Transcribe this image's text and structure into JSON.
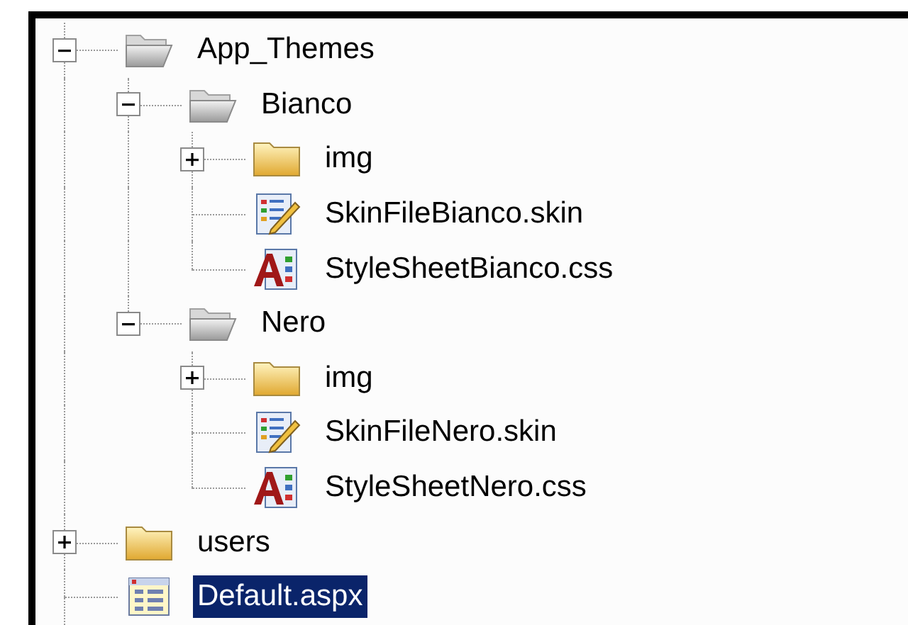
{
  "tree": [
    {
      "label": "App_Themes",
      "kind": "folder",
      "expanded": true,
      "selected": false,
      "children": [
        {
          "label": "Bianco",
          "kind": "folder",
          "expanded": true,
          "selected": false,
          "children": [
            {
              "label": "img",
              "kind": "folder",
              "expanded": false,
              "selected": false
            },
            {
              "label": "SkinFileBianco.skin",
              "kind": "skin",
              "selected": false
            },
            {
              "label": "StyleSheetBianco.css",
              "kind": "css",
              "selected": false
            }
          ]
        },
        {
          "label": "Nero",
          "kind": "folder",
          "expanded": true,
          "selected": false,
          "children": [
            {
              "label": "img",
              "kind": "folder",
              "expanded": false,
              "selected": false
            },
            {
              "label": "SkinFileNero.skin",
              "kind": "skin",
              "selected": false
            },
            {
              "label": "StyleSheetNero.css",
              "kind": "css",
              "selected": false
            }
          ]
        }
      ]
    },
    {
      "label": "users",
      "kind": "folder",
      "expanded": false,
      "selected": false
    },
    {
      "label": "Default.aspx",
      "kind": "aspx",
      "selected": true
    }
  ]
}
